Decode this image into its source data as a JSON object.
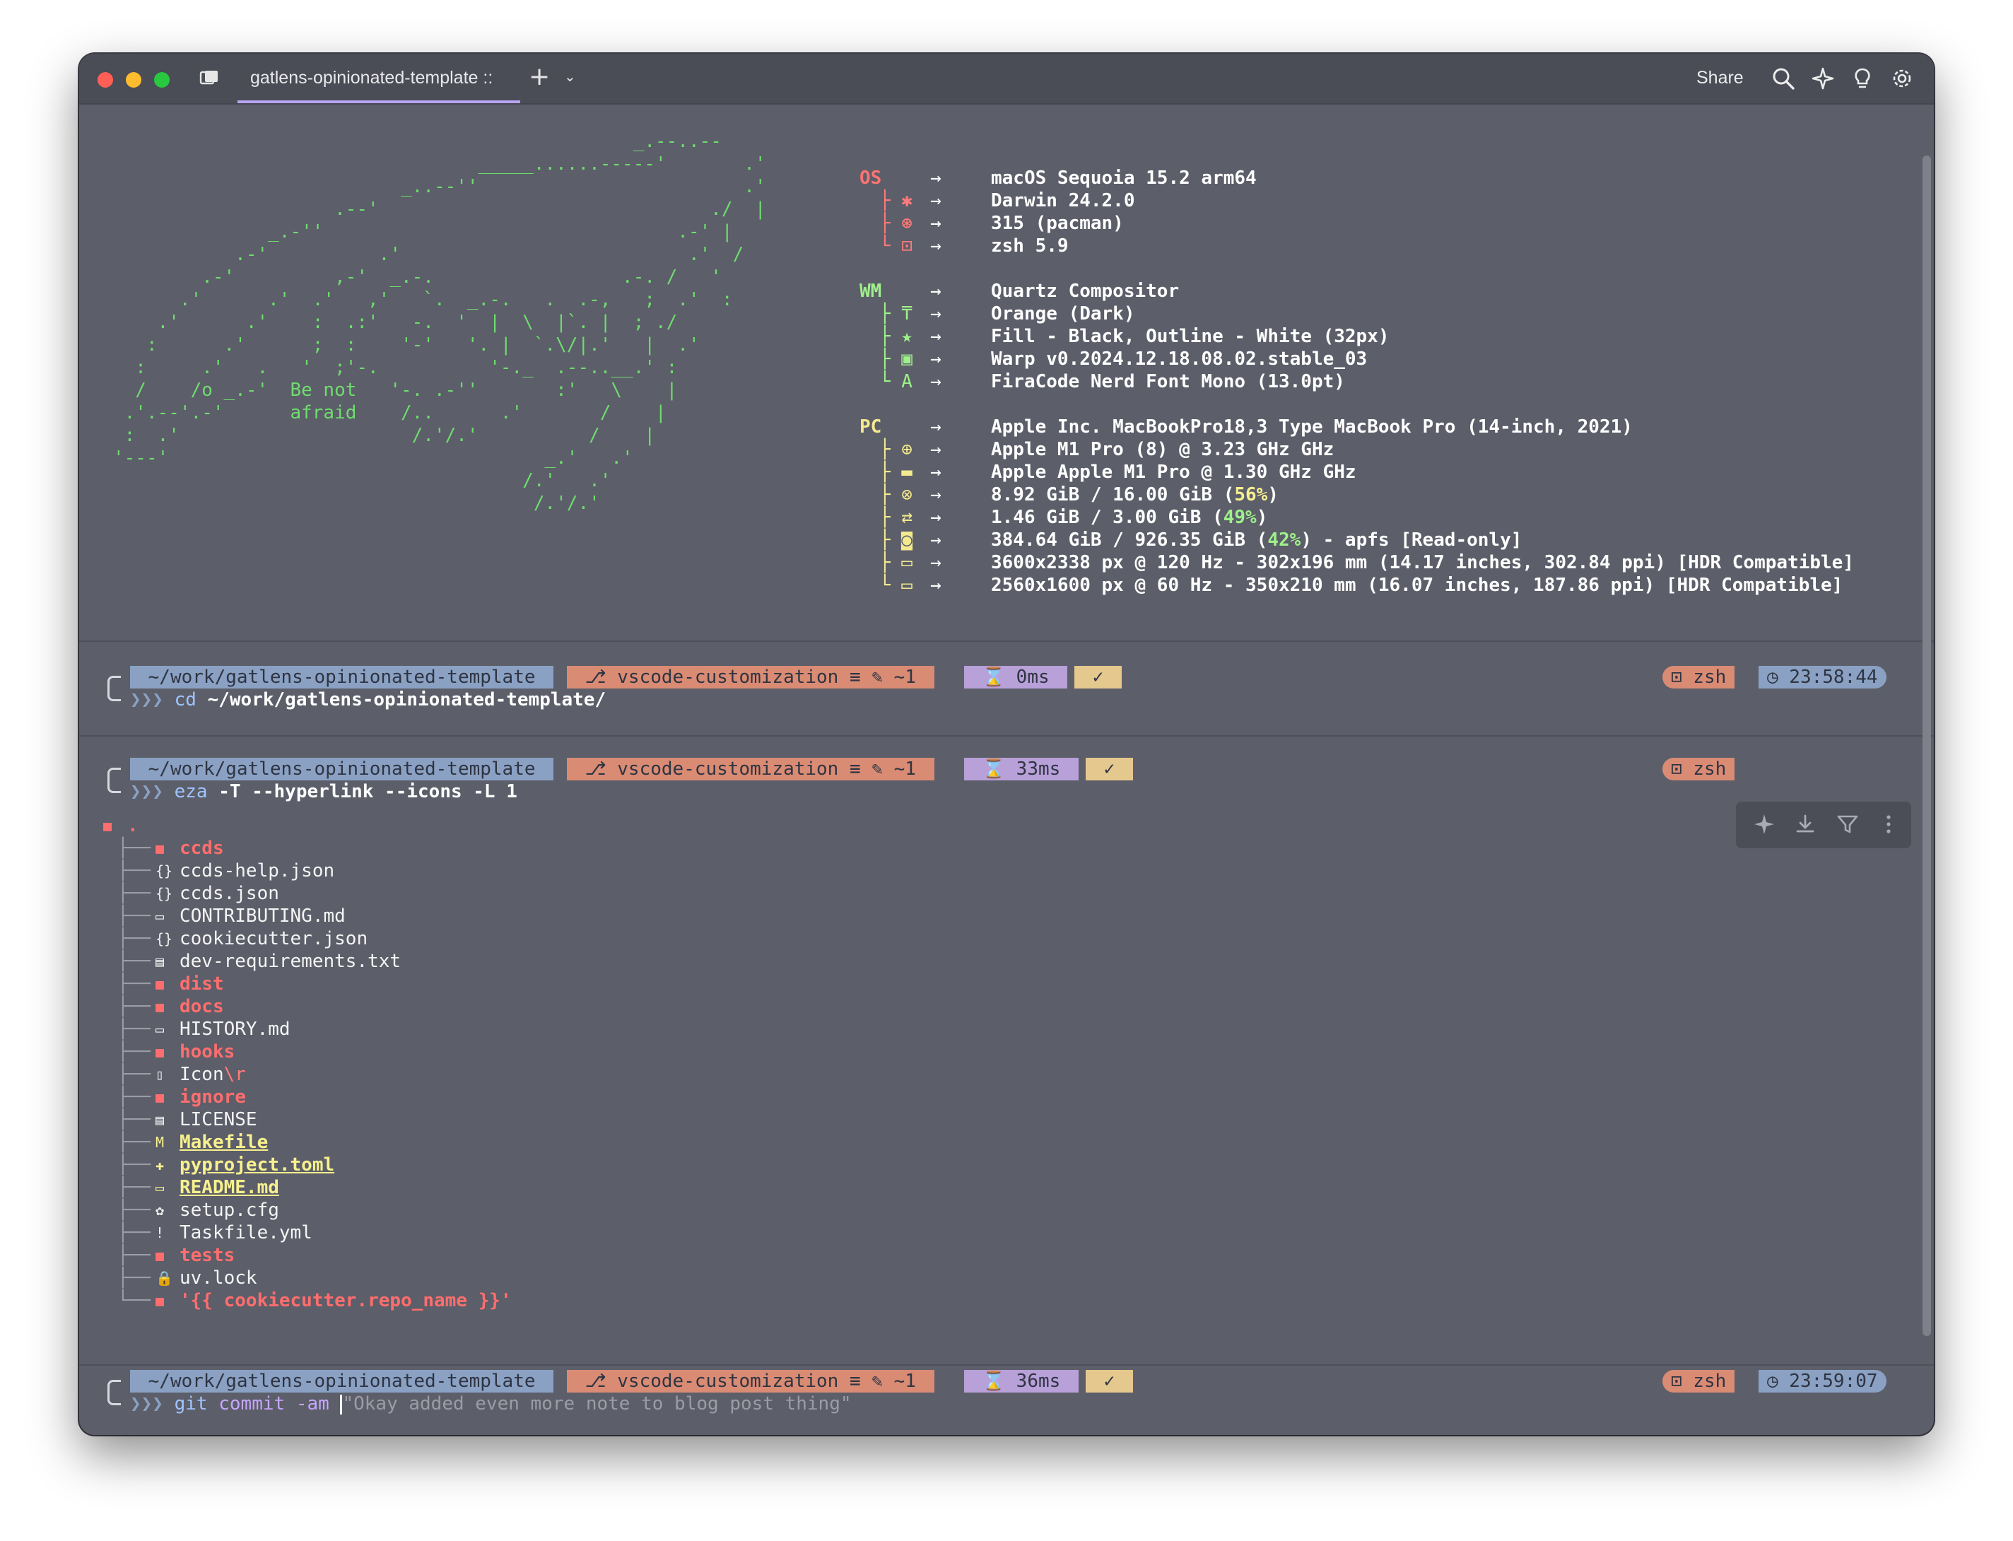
{
  "window": {
    "tab_title": "gatlens-opinionated-template ::",
    "share_label": "Share",
    "new_tab_label": "+",
    "icons": [
      "panel-icon",
      "search-icon",
      "sparkle-icon",
      "lightbulb-icon",
      "gear-icon"
    ]
  },
  "fetch": {
    "ascii_art": "                                               _.--..--\n                                 _____......-----'       .'\n                          _..--''                        .'\n                    .--'                              ./  |\n              _.-''                                .-' |\n           .-'          .'                          .'  /\n        .-'         ,-'  _.-.                 .-. /   '\n      .'      .'  .'   ,'   `.  _.-.   .  .-,   ;  .'  :\n    .'      .'    :  .:'   -.  '  |  \\  |`. |  ; ./\n   :      .'      ;  :    '-'   '. |  `.\\/|.'   |  .'\n  :     .'   .   '  ;'-.          '-._  .--..__.' :\n  /    /o _.-'  Be not   '-. .-''       :'   \\    |\n .'.--'.-'      afraid    /..      .'       /    |\n :  .'                     /.'/.'          /    |\n'---'                                  _.'   .'\n                                     /.'   .'\n                                      /.'/.'",
    "sections": [
      {
        "key": "OS",
        "rows": [
          {
            "glyph": "",
            "value": "macOS Sequoia 15.2 arm64"
          },
          {
            "glyph": "├ ✱",
            "value": "Darwin 24.2.0"
          },
          {
            "glyph": "├ ⊛",
            "value": "315 (pacman)"
          },
          {
            "glyph": "└ ⊡",
            "value": "zsh 5.9"
          }
        ]
      },
      {
        "key": "WM",
        "rows": [
          {
            "glyph": "",
            "value": "Quartz Compositor"
          },
          {
            "glyph": "├ ₸",
            "value": "Orange (Dark)"
          },
          {
            "glyph": "├ ★",
            "value": "Fill - Black, Outline - White (32px)"
          },
          {
            "glyph": "├ ▣",
            "value": "Warp v0.2024.12.18.08.02.stable_03"
          },
          {
            "glyph": "└ A",
            "value": "FiraCode Nerd Font Mono (13.0pt)"
          }
        ]
      },
      {
        "key": "PC",
        "rows": [
          {
            "glyph": "",
            "value": "Apple Inc. MacBookPro18,3 Type MacBook Pro (14-inch, 2021)"
          },
          {
            "glyph": "├ ⊕",
            "value": "Apple M1 Pro (8) @ 3.23 GHz GHz"
          },
          {
            "glyph": "├ ▬",
            "value": "Apple Apple M1 Pro @ 1.30 GHz GHz"
          },
          {
            "glyph": "├ ⊗",
            "value_pre": "8.92 GiB / 16.00 GiB (",
            "pct": "56%",
            "pct_color": "yellow",
            "value_post": ")"
          },
          {
            "glyph": "├ ⇄",
            "value_pre": "1.46 GiB / 3.00 GiB (",
            "pct": "49%",
            "pct_color": "green",
            "value_post": ")"
          },
          {
            "glyph": "├ ◙",
            "value_pre": "384.64 GiB / 926.35 GiB (",
            "pct": "42%",
            "pct_color": "green",
            "value_post": ") - apfs [Read-only]"
          },
          {
            "glyph": "├ ▭",
            "value": "3600x2338 px @ 120 Hz - 302x196 mm (14.17 inches, 302.84 ppi) [HDR Compatible]"
          },
          {
            "glyph": "└ ▭",
            "value": "2560x1600 px @ 60 Hz - 350x210 mm (16.07 inches, 187.86 ppi) [HDR Compatible]"
          }
        ]
      }
    ],
    "arrow": "→"
  },
  "blocks": [
    {
      "path": " ~/work/gatlens-opinionated-template ",
      "git": " ⎇ vscode-customization ≡ ✎ ~1 ",
      "duration": " ⌛ 0ms ",
      "status": " ✓ ",
      "shell": "⊡ zsh",
      "time": "◷ 23:58:44",
      "prompt_chevrons": "❯❯❯ ",
      "command": "cd",
      "args": " ~/work/gatlens-opinionated-template/"
    },
    {
      "path": " ~/work/gatlens-opinionated-template ",
      "git": " ⎇ vscode-customization ≡ ✎ ~1 ",
      "duration": " ⌛ 33ms ",
      "status": " ✓ ",
      "shell": "⊡ zsh",
      "prompt_chevrons": "❯❯❯ ",
      "command": "eza",
      "args": " -T --hyperlink --icons -L 1"
    },
    {
      "path": " ~/work/gatlens-opinionated-template ",
      "git": " ⎇ vscode-customization ≡ ✎ ~1 ",
      "duration": " ⌛ 36ms ",
      "status": " ✓ ",
      "shell": "⊡ zsh",
      "time": "◷ 23:59:07",
      "prompt_chevrons": "❯❯❯ ",
      "command": "git",
      "args": " commit",
      "flag": " -am ",
      "ghost": "\"Okay added even more note to blog post thing\""
    }
  ],
  "tree": {
    "root": ".",
    "entries": [
      {
        "icon": "■",
        "name": "ccds",
        "kind": "dir"
      },
      {
        "icon": "{}",
        "name": "ccds-help.json",
        "kind": "file"
      },
      {
        "icon": "{}",
        "name": "ccds.json",
        "kind": "file"
      },
      {
        "icon": "▭",
        "name": "CONTRIBUTING.md",
        "kind": "file"
      },
      {
        "icon": "{}",
        "name": "cookiecutter.json",
        "kind": "file"
      },
      {
        "icon": "▤",
        "name": "dev-requirements.txt",
        "kind": "file"
      },
      {
        "icon": "■",
        "name": "dist",
        "kind": "dir"
      },
      {
        "icon": "■",
        "name": "docs",
        "kind": "dir"
      },
      {
        "icon": "▭",
        "name": "HISTORY.md",
        "kind": "file"
      },
      {
        "icon": "■",
        "name": "hooks",
        "kind": "dir"
      },
      {
        "icon": "▯",
        "name": "Icon",
        "suffix": "\\r",
        "kind": "file"
      },
      {
        "icon": "■",
        "name": "ignore",
        "kind": "dir"
      },
      {
        "icon": "▤",
        "name": "LICENSE",
        "kind": "file"
      },
      {
        "icon": "M",
        "name": "Makefile",
        "kind": "special"
      },
      {
        "icon": "✚",
        "name": "pyproject.toml",
        "kind": "special"
      },
      {
        "icon": "▭",
        "name": "README.md",
        "kind": "special"
      },
      {
        "icon": "✿",
        "name": "setup.cfg",
        "kind": "file"
      },
      {
        "icon": "!",
        "name": "Taskfile.yml",
        "kind": "file"
      },
      {
        "icon": "■",
        "name": "tests",
        "kind": "dir"
      },
      {
        "icon": "🔒",
        "name": "uv.lock",
        "kind": "file"
      },
      {
        "icon": "■",
        "name": "'{{ cookiecutter.repo_name }}'",
        "kind": "dir"
      }
    ]
  }
}
